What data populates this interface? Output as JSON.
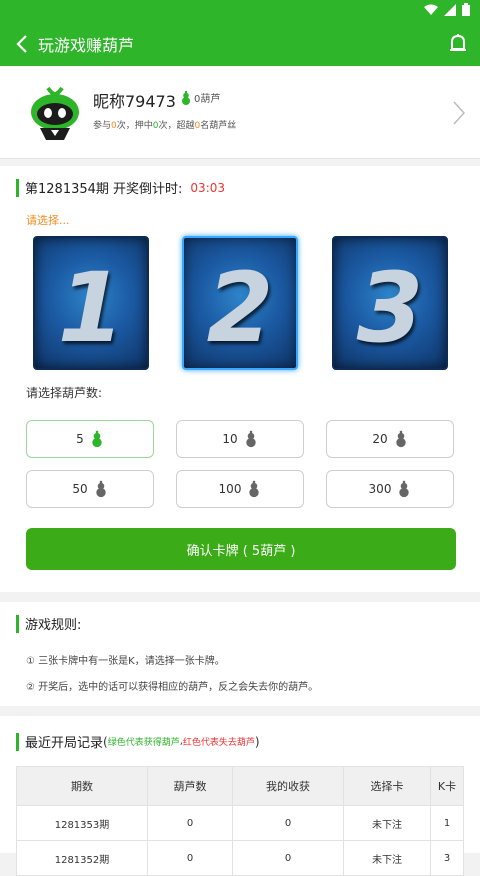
{
  "header": {
    "title": "玩游戏赚葫芦"
  },
  "profile": {
    "nickname": "昵称79473",
    "gourds": "0葫芦",
    "stats_p1": "参与",
    "stats_v1": "0",
    "stats_p2": "次，押中",
    "stats_v2": "0",
    "stats_p3": "次，超越",
    "stats_v3": "0",
    "stats_p4": "名葫芦丝"
  },
  "game": {
    "period_label": "第1281354期 开奖倒计时:",
    "countdown": "03:03",
    "choose_hint": "请选择...",
    "cards": [
      "1",
      "2",
      "3"
    ],
    "selected_card_index": 1,
    "amount_label": "请选择葫芦数:",
    "amounts": [
      "5",
      "10",
      "20",
      "50",
      "100",
      "300"
    ],
    "selected_amount_index": 0,
    "confirm_label": "确认卡牌 ( 5葫芦 )"
  },
  "rules": {
    "title": "游戏规则:",
    "items": [
      "① 三张卡牌中有一张是K，请选择一张卡牌。",
      "② 开奖后，选中的话可以获得相应的葫芦，反之会失去你的葫芦。"
    ]
  },
  "history": {
    "title": "最近开局记录",
    "legend_open": "(",
    "legend_green": "绿色代表获得葫芦",
    "legend_sep": ",",
    "legend_red": "红色代表失去葫芦",
    "legend_close": ")",
    "columns": [
      "期数",
      "葫芦数",
      "我的收获",
      "选择卡",
      "K卡"
    ],
    "rows": [
      [
        "1281353期",
        "0",
        "0",
        "未下注",
        "1"
      ],
      [
        "1281352期",
        "0",
        "0",
        "未下注",
        "3"
      ]
    ]
  },
  "colors": {
    "primary": "#2fb52a",
    "button": "#3bab17",
    "accent_orange": "#f58b1e",
    "accent_red": "#ee3333"
  }
}
